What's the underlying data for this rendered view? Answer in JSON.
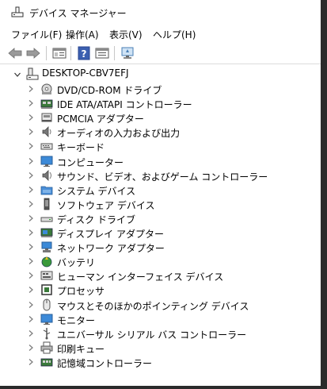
{
  "window": {
    "title": "デバイス マネージャー"
  },
  "menu": [
    {
      "label": "ファイル(F)"
    },
    {
      "label": "操作(A)"
    },
    {
      "label": "表示(V)"
    },
    {
      "label": "ヘルプ(H)"
    }
  ],
  "toolbar": {
    "buttons": [
      "back-arrow-icon",
      "forward-arrow-icon",
      "properties-icon",
      "help-icon",
      "view-icon",
      "monitor-scan-icon"
    ]
  },
  "tree": {
    "root": {
      "label": "DESKTOP-CBV7EFJ",
      "icon": "computer-icon"
    },
    "items": [
      {
        "label": "DVD/CD-ROM ドライブ",
        "icon": "dvd-drive-icon"
      },
      {
        "label": "IDE ATA/ATAPI コントローラー",
        "icon": "ide-controller-icon"
      },
      {
        "label": "PCMCIA アダプター",
        "icon": "pcmcia-icon"
      },
      {
        "label": "オーディオの入力および出力",
        "icon": "speaker-icon"
      },
      {
        "label": "キーボード",
        "icon": "keyboard-icon"
      },
      {
        "label": "コンピューター",
        "icon": "monitor-icon"
      },
      {
        "label": "サウンド、ビデオ、およびゲーム コントローラー",
        "icon": "sound-icon"
      },
      {
        "label": "システム デバイス",
        "icon": "system-folder-icon"
      },
      {
        "label": "ソフトウェア デバイス",
        "icon": "software-device-icon"
      },
      {
        "label": "ディスク ドライブ",
        "icon": "disk-drive-icon"
      },
      {
        "label": "ディスプレイ アダプター",
        "icon": "display-adapter-icon"
      },
      {
        "label": "ネットワーク アダプター",
        "icon": "network-adapter-icon"
      },
      {
        "label": "バッテリ",
        "icon": "battery-icon"
      },
      {
        "label": "ヒューマン インターフェイス デバイス",
        "icon": "hid-icon"
      },
      {
        "label": "プロセッサ",
        "icon": "processor-icon"
      },
      {
        "label": "マウスとそのほかのポインティング デバイス",
        "icon": "mouse-icon"
      },
      {
        "label": "モニター",
        "icon": "monitor-icon"
      },
      {
        "label": "ユニバーサル シリアル バス コントローラー",
        "icon": "usb-icon"
      },
      {
        "label": "印刷キュー",
        "icon": "printer-icon"
      },
      {
        "label": "記憶域コントローラー",
        "icon": "storage-controller-icon"
      }
    ]
  },
  "colors": {
    "accent": "#3c78c8",
    "icon_gray": "#6e6e6e",
    "chevron": "#7a7a7a"
  }
}
